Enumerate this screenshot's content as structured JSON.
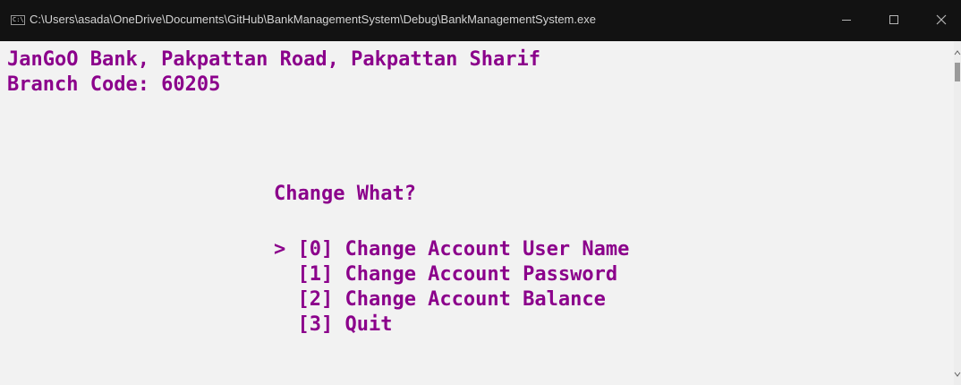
{
  "window": {
    "title": "C:\\Users\\asada\\OneDrive\\Documents\\GitHub\\BankManagementSystem\\Debug\\BankManagementSystem.exe",
    "icon_text": "C:\\",
    "colors": {
      "titlebar": "#121212",
      "console_background": "#f2f2f2",
      "console_text": "#8b008b"
    }
  },
  "console": {
    "lines": [
      "JanGoO Bank, Pakpattan Road, Pakpattan Sharif",
      "Branch Code: 60205",
      "Change What?",
      "> [0] Change Account User Name",
      "  [1] Change Account Password",
      "  [2] Change Account Balance",
      "  [3] Quit"
    ]
  },
  "icons": {
    "app": "terminal-icon",
    "minimize": "minimize-icon",
    "maximize": "maximize-icon",
    "close": "close-icon"
  }
}
